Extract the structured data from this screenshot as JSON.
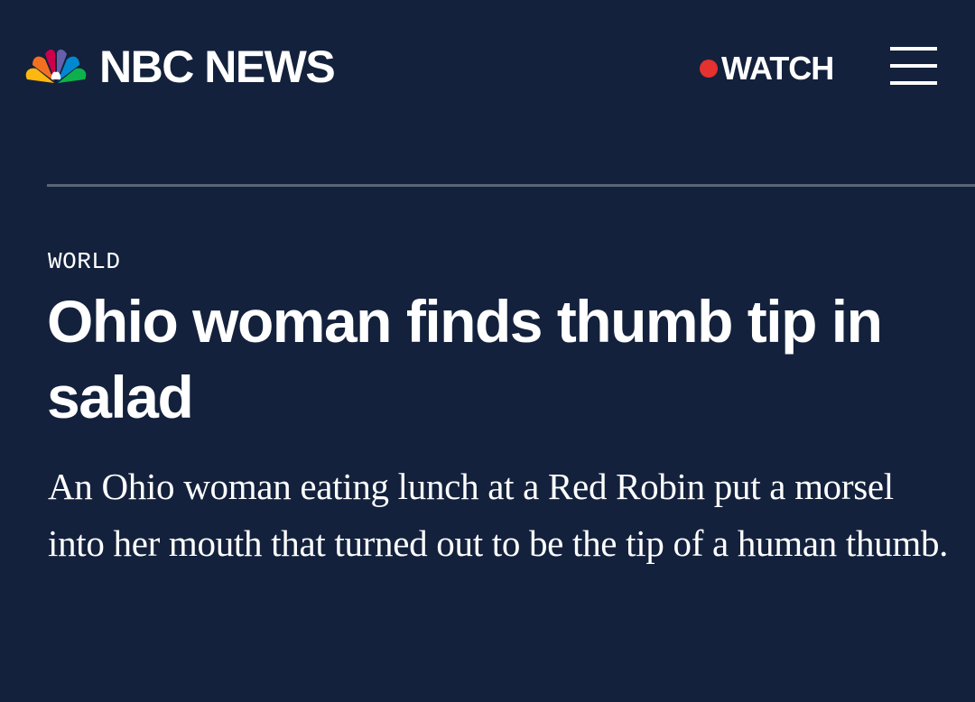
{
  "header": {
    "brand": "NBC NEWS",
    "watch_label": "WATCH",
    "peacock_colors": [
      "#fcb711",
      "#f37021",
      "#cc004c",
      "#6460aa",
      "#0089d0",
      "#0db14b"
    ],
    "live_dot_color": "#e5312f"
  },
  "article": {
    "section": "WORLD",
    "headline": "Ohio woman finds thumb tip in salad",
    "dek": "An Ohio woman eating lunch at a Red Robin put a morsel into her mouth that turned out to be the tip of a human thumb."
  },
  "theme": {
    "background": "#13213c",
    "divider": "#5a6478",
    "text": "#ffffff"
  }
}
